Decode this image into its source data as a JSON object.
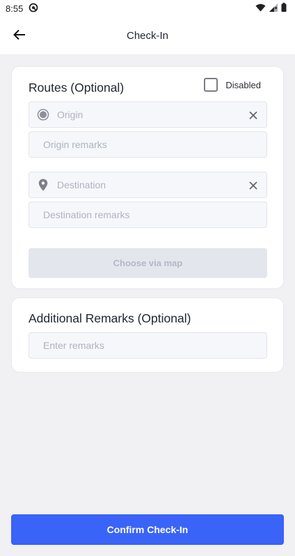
{
  "status_bar": {
    "time": "8:55",
    "icons": [
      "at-icon",
      "wifi-icon",
      "signal-icon",
      "battery-icon"
    ]
  },
  "app_bar": {
    "back_icon": "arrow-left-icon",
    "title": "Check-In"
  },
  "routes": {
    "title": "Routes (Optional)",
    "disabled_label": "Disabled",
    "disabled_checked": false,
    "origin": {
      "placeholder": "Origin",
      "value": "",
      "icon": "radio-dot-icon",
      "clear_icon": "close-icon"
    },
    "origin_remarks": {
      "placeholder": "Origin remarks",
      "value": ""
    },
    "destination": {
      "placeholder": "Destination",
      "value": "",
      "icon": "location-pin-icon",
      "clear_icon": "close-icon"
    },
    "destination_remarks": {
      "placeholder": "Destination remarks",
      "value": ""
    },
    "choose_map_label": "Choose via map"
  },
  "additional": {
    "title": "Additional Remarks (Optional)",
    "remarks": {
      "placeholder": "Enter remarks",
      "value": ""
    }
  },
  "confirm_label": "Confirm Check-In",
  "colors": {
    "accent": "#3a63f8",
    "disabled_button": "#e4e6ee",
    "background": "#f1f1f3",
    "field_bg": "#f6f7fb"
  }
}
